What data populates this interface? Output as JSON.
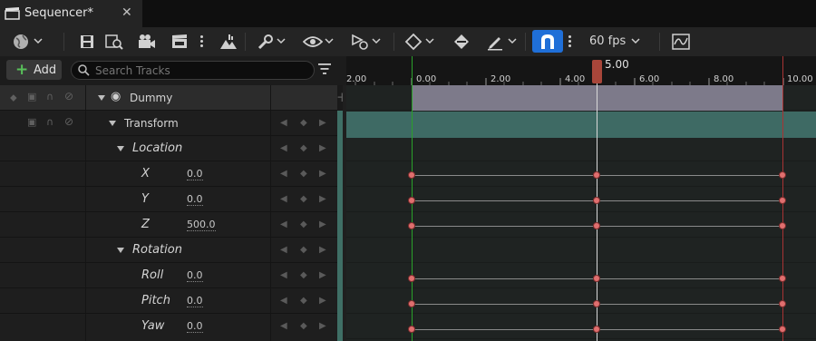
{
  "tab": {
    "title": "Sequencer*",
    "close": "✕",
    "icon": "clapperboard-icon"
  },
  "toolbar": {
    "fps": "60 fps",
    "snap_active_color": "#1f6fd8",
    "icons": [
      "world-icon",
      "save-icon",
      "find-icon",
      "camera-icon",
      "render-icon",
      "more-icon",
      "actor-icon",
      "wrench-icon",
      "eye-icon",
      "sequence-icon",
      "key-icon",
      "keyframe-icon",
      "pencil-icon",
      "magnet-icon",
      "curve-editor-icon"
    ]
  },
  "search": {
    "add_label": "Add",
    "placeholder": "Search Tracks"
  },
  "tracks": [
    {
      "name": "Dummy",
      "value": ""
    },
    {
      "name": "Transform",
      "value": ""
    },
    {
      "name": "Location",
      "value": ""
    },
    {
      "name": "X",
      "value": "0.0"
    },
    {
      "name": "Y",
      "value": "0.0"
    },
    {
      "name": "Z",
      "value": "500.0"
    },
    {
      "name": "Rotation",
      "value": ""
    },
    {
      "name": "Roll",
      "value": "0.0"
    },
    {
      "name": "Pitch",
      "value": "0.0"
    },
    {
      "name": "Yaw",
      "value": "0.0"
    }
  ],
  "timeline": {
    "playhead_label": "5.00",
    "tick_labels": [
      "2.00",
      "0.00",
      "2.00",
      "4.00",
      "6.00",
      "8.00",
      "10.00"
    ],
    "start_color": "#2aa12a",
    "end_color": "#a83333",
    "keyframe_color": "#e06f6f"
  }
}
